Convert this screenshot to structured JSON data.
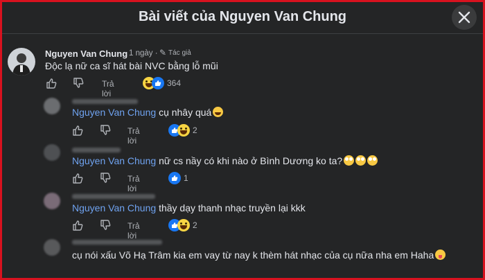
{
  "header": {
    "title": "Bài viết của Nguyen Van Chung"
  },
  "actions": {
    "reply_label": "Trả lời"
  },
  "comments": [
    {
      "author": "Nguyen Van Chung",
      "time": "· 1 ngày ·",
      "badge": "Tác giả",
      "text": "Độc lạ nữ ca sĩ hát bài NVC bằng lỗ mũi",
      "reaction_count": "364"
    },
    {
      "mention": "Nguyen Van Chung",
      "text": "cụ nhây quá",
      "reaction_count": "2"
    },
    {
      "mention": "Nguyen Van Chung",
      "text": "nữ cs nầy có khi nào ở Bình Dương ko ta?",
      "reaction_count": "1"
    },
    {
      "mention": "Nguyen Van Chung",
      "text": "thầy dạy thanh nhạc truyền lại kkk",
      "reaction_count": "2"
    },
    {
      "text": "cụ nói xấu Võ Hạ Trâm kia em vay từ nay k thèm hát nhạc của cụ nữa nha em Haha"
    }
  ],
  "colors": {
    "accent": "#1877f2",
    "mention": "#6fa2ef",
    "frame_border": "#d8121f",
    "background": "#242526"
  }
}
